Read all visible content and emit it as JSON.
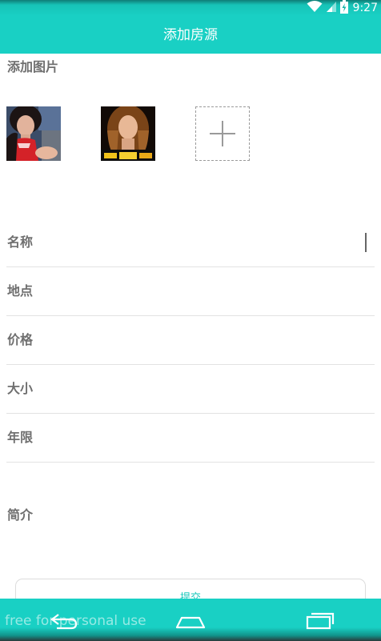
{
  "status_bar": {
    "time": "9:27",
    "icons": [
      "wifi-icon",
      "signal-icon",
      "battery-charging-icon"
    ]
  },
  "header": {
    "title": "添加房源"
  },
  "images_section": {
    "label": "添加图片",
    "photos": [
      "photo-1",
      "photo-2"
    ],
    "add_icon": "plus-icon"
  },
  "form": {
    "fields": [
      {
        "label": "名称",
        "value": ""
      },
      {
        "label": "地点",
        "value": ""
      },
      {
        "label": "价格",
        "value": ""
      },
      {
        "label": "大小",
        "value": ""
      },
      {
        "label": "年限",
        "value": ""
      }
    ],
    "intro_label": "简介",
    "intro_value": ""
  },
  "submit": {
    "label": "提交"
  },
  "nav": {
    "icons": [
      "back-icon",
      "home-icon",
      "recents-icon"
    ]
  },
  "watermark": "free for personal use"
}
